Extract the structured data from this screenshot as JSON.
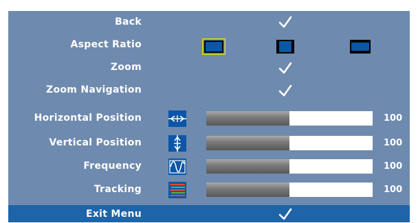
{
  "menu": {
    "back_label": "Back",
    "aspect_ratio": {
      "label": "Aspect Ratio",
      "options": [
        "aspect-16-9-icon",
        "aspect-4-3-icon",
        "aspect-letterbox-icon"
      ],
      "selected": 0
    },
    "zoom_label": "Zoom",
    "zoom_navigation_label": "Zoom Navigation",
    "sliders": [
      {
        "label": "Horizontal Position",
        "icon": "horizontal-position-icon",
        "value": "100",
        "level": 0.5
      },
      {
        "label": "Vertical Position",
        "icon": "vertical-position-icon",
        "value": "100",
        "level": 0.5
      },
      {
        "label": "Frequency",
        "icon": "frequency-icon",
        "value": "100",
        "level": 0.5
      },
      {
        "label": "Tracking",
        "icon": "tracking-icon",
        "value": "100",
        "level": 0.5
      }
    ],
    "exit_label": "Exit Menu"
  },
  "colors": {
    "panel": "#6e8aae",
    "exit_bar": "#1d64a8",
    "highlight": "#e8e200",
    "icon_blue": "#0b56a6"
  }
}
